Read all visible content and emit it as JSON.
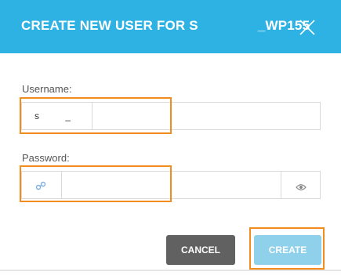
{
  "dialog": {
    "title_prefix": "CREATE NEW USER FOR S",
    "title_suffix": "_WP155"
  },
  "username": {
    "label": "Username:",
    "prefix": "s          _",
    "value": "",
    "placeholder": ""
  },
  "password": {
    "label": "Password:",
    "value": "",
    "placeholder": ""
  },
  "buttons": {
    "cancel": "CANCEL",
    "create": "CREATE"
  },
  "colors": {
    "header": "#2eb2e4",
    "highlight": "#f28c1e",
    "cancel_button": "#616161",
    "create_button": "#8fd0ea"
  },
  "icons": {
    "close": "close-icon",
    "generate_password": "key-icon",
    "show_password": "eye-icon"
  }
}
